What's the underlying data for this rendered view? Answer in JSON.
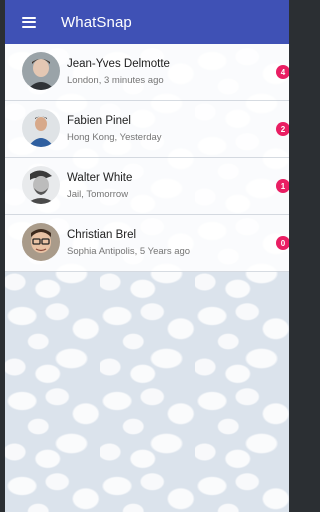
{
  "app": {
    "title": "WhatSnap",
    "accent_color": "#3f51b5",
    "badge_color": "#e91e63"
  },
  "contacts": [
    {
      "name": "Jean-Yves Delmotte",
      "subtitle": "London, 3 minutes ago",
      "unread": "4",
      "avatar": "avatar-icon"
    },
    {
      "name": "Fabien Pinel",
      "subtitle": "Hong Kong, Yesterday",
      "unread": "2",
      "avatar": "avatar-icon"
    },
    {
      "name": "Walter White",
      "subtitle": "Jail, Tomorrow",
      "unread": "1",
      "avatar": "avatar-icon"
    },
    {
      "name": "Christian Brel",
      "subtitle": "Sophia Antipolis, 5 Years ago",
      "unread": "0",
      "avatar": "avatar-icon"
    }
  ]
}
